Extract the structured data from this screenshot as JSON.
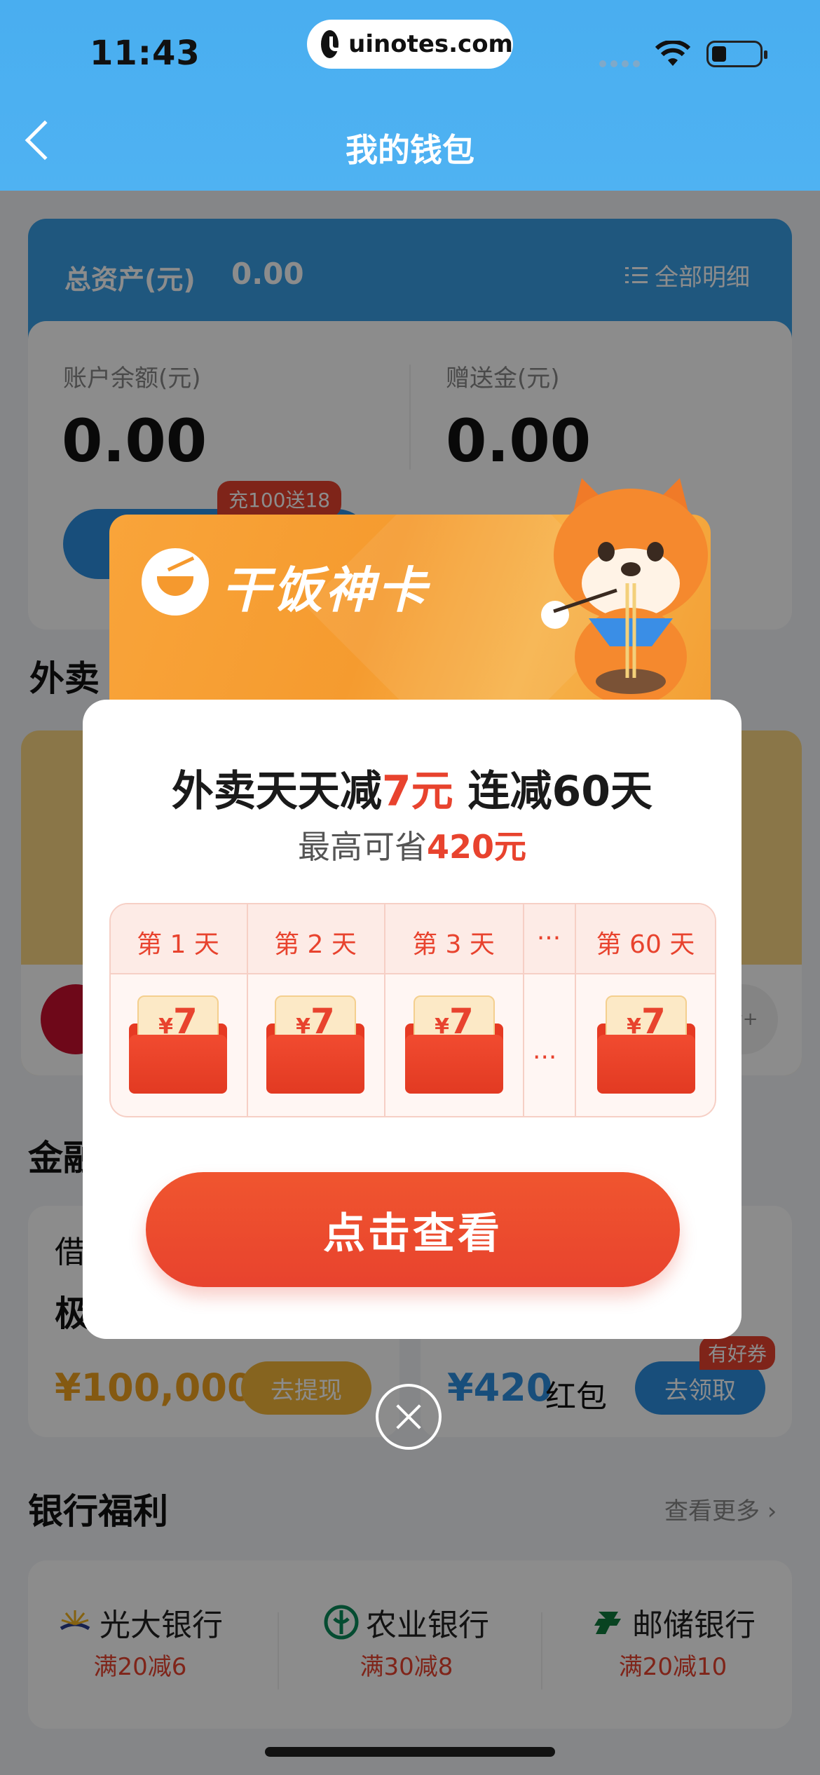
{
  "status_bar": {
    "time": "11:43",
    "url": "uinotes.com"
  },
  "nav": {
    "title": "我的钱包"
  },
  "assets": {
    "label": "总资产(元)",
    "value": "0.00",
    "detail_link": "全部明细"
  },
  "balance": {
    "account_label": "账户余额(元)",
    "account_value": "0.00",
    "gift_label": "赠送金(元)",
    "gift_value": "0.00",
    "recharge_tag": "充100送18"
  },
  "sections": {
    "waimai": "外卖",
    "finance": "金融",
    "bank": "银行福利"
  },
  "waimai_strip": {
    "more_logo_text": "w+"
  },
  "finance": {
    "left_label": "借",
    "left_sub": "极",
    "left_amount": "¥100,000",
    "left_button": "去提现",
    "right_amount": "¥420",
    "right_unit": "红包",
    "right_button": "去领取",
    "right_tag": "有好券"
  },
  "bank_more": "查看更多",
  "banks": [
    {
      "name": "光大银行",
      "offer": "满20减6",
      "icon": "everbright-bank-icon"
    },
    {
      "name": "农业银行",
      "offer": "满30减8",
      "icon": "abc-bank-icon"
    },
    {
      "name": "邮储银行",
      "offer": "满20减10",
      "icon": "psbc-bank-icon"
    }
  ],
  "modal": {
    "brand": "干饭神卡",
    "headline_pre": "外卖天天减",
    "headline_red": "7元",
    "headline_post": " 连减60天",
    "sub_pre": "最高可省",
    "sub_red": "420元",
    "days": [
      {
        "label": "第 1 天",
        "amount": "7",
        "currency": "¥"
      },
      {
        "label": "第 2 天",
        "amount": "7",
        "currency": "¥"
      },
      {
        "label": "第 3 天",
        "amount": "7",
        "currency": "¥"
      },
      {
        "label": "第 60 天",
        "amount": "7",
        "currency": "¥"
      }
    ],
    "ellipsis": "···",
    "cta": "点击查看"
  },
  "colors": {
    "accent": "#e8432e",
    "brand_orange": "#f59b2f",
    "nav_blue": "#4fb2f2"
  }
}
